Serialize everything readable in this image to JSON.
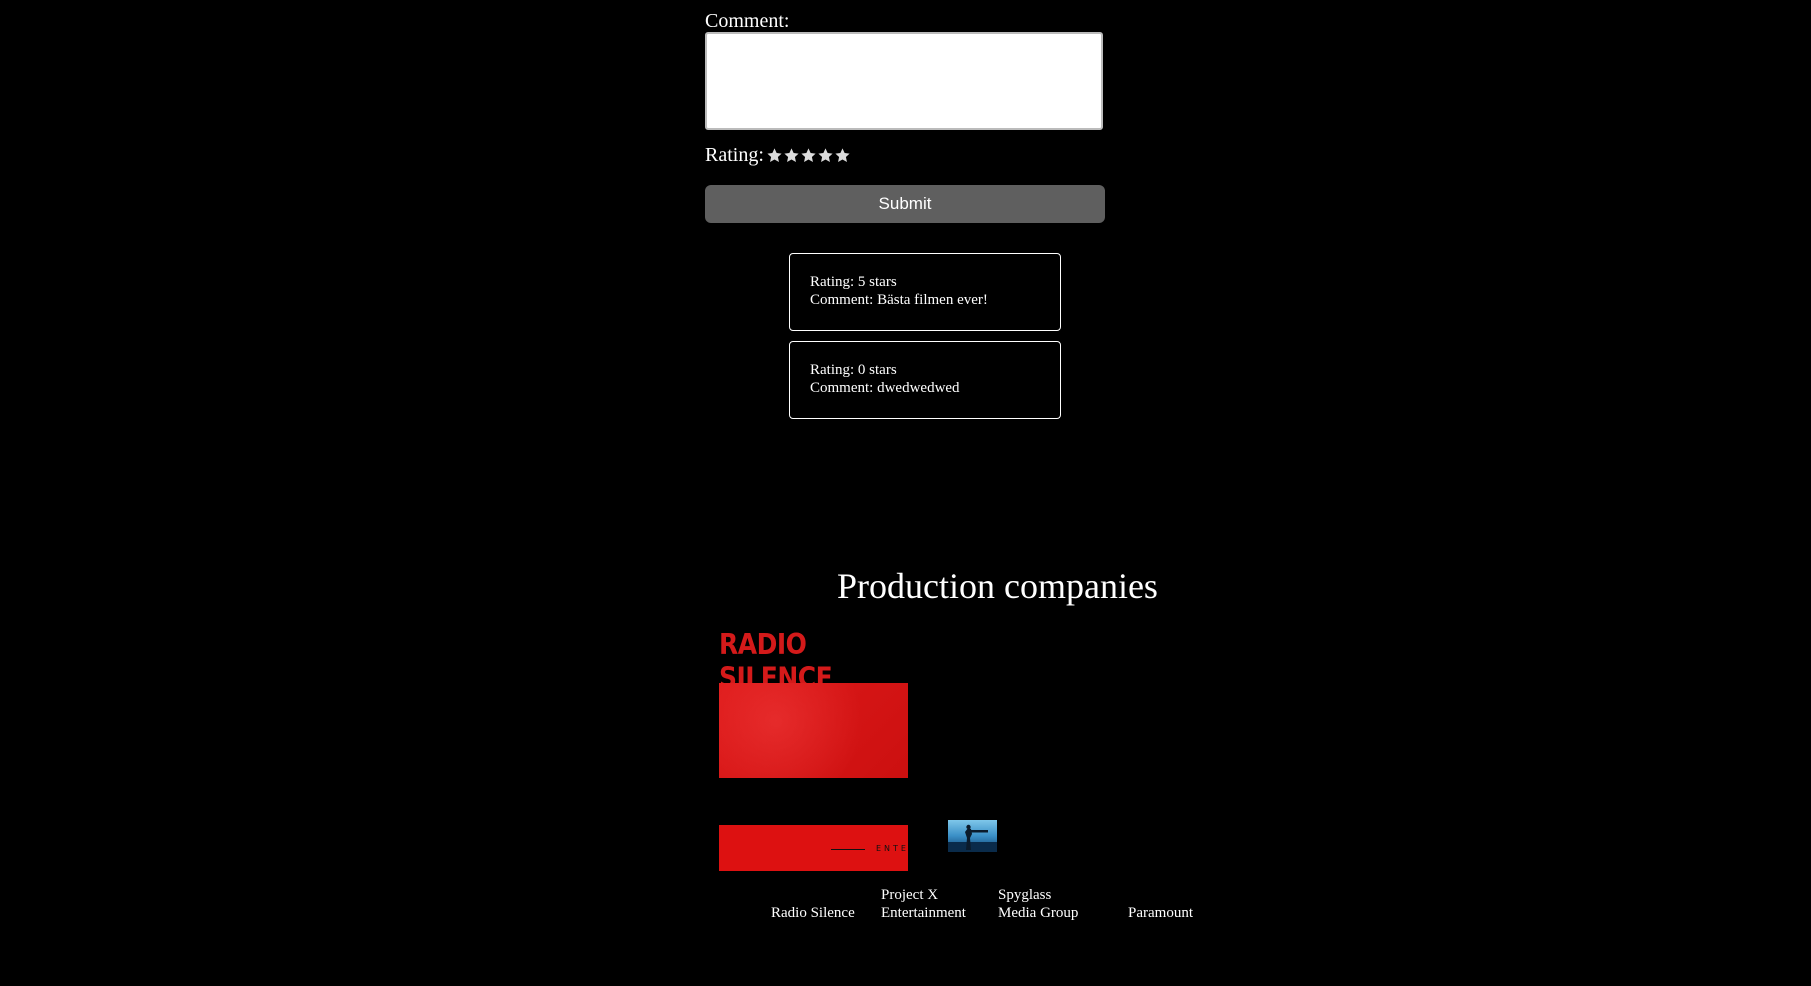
{
  "form": {
    "comment_label": "Comment:",
    "comment_value": "",
    "rating_label": "Rating:",
    "star_count": 5,
    "star_icon": "star-icon",
    "submit_label": "Submit"
  },
  "reviews": [
    {
      "rating_text": "Rating: 5 stars",
      "comment_text": "Comment: Bästa filmen ever!"
    },
    {
      "rating_text": "Rating: 0 stars",
      "comment_text": "Comment: dwedwedwed"
    }
  ],
  "production": {
    "title": "Production companies",
    "companies": [
      {
        "name": "Radio Silence",
        "logo_text": "RADIO SILENCE"
      },
      {
        "name_line1": "Project X",
        "name_line2": "Entertainment",
        "logo_text": "ENTE"
      },
      {
        "name_line1": "Spyglass",
        "name_line2": "Media Group"
      },
      {
        "name": "Paramount"
      }
    ]
  },
  "colors": {
    "background": "#000000",
    "text": "#ffffff",
    "button": "#5f5f5f",
    "logo_red": "#dd1111"
  }
}
